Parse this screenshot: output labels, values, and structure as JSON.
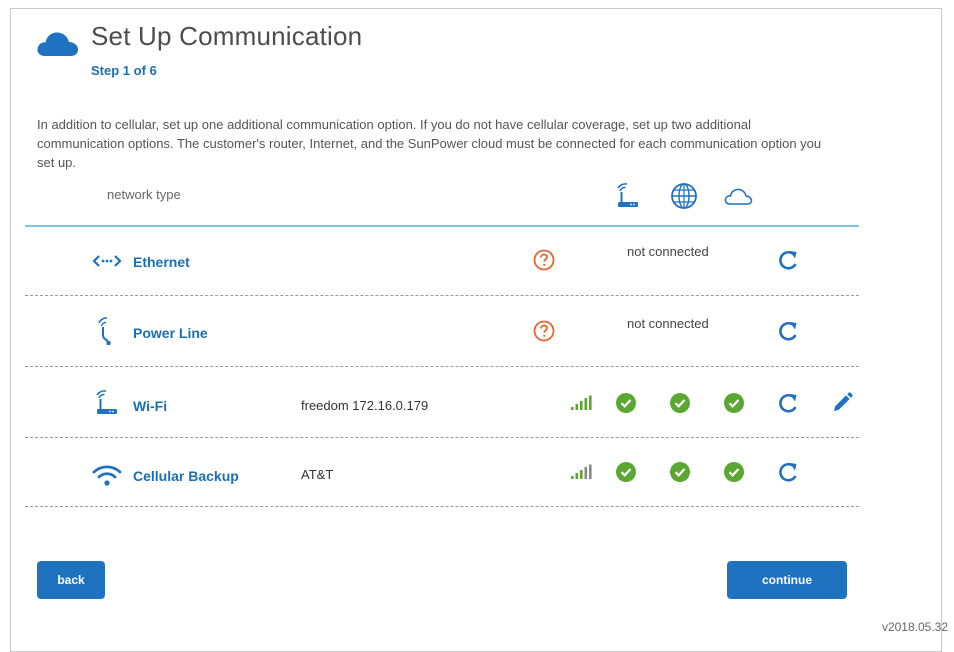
{
  "header": {
    "icon": "cloud-icon",
    "title": "Set Up Communication",
    "step": "Step 1 of 6"
  },
  "intro": {
    "text": "In addition to cellular, set up one additional communication option. If you do not have cellular coverage, set up two additional communication options. The customer's router, Internet, and the SunPower cloud must be connected for each communication option you set up."
  },
  "table": {
    "column_label": "network type",
    "column_icons": [
      "router-icon",
      "globe-icon",
      "cloud-outline-icon"
    ],
    "rows": [
      {
        "icon": "ethernet-icon",
        "label": "Ethernet",
        "detail": "",
        "status_icon": "question-circle-icon",
        "status_text": "not connected",
        "action_icon": "refresh-icon"
      },
      {
        "icon": "power-line-icon",
        "label": "Power Line",
        "detail": "",
        "status_icon": "question-circle-icon",
        "status_text": "not connected",
        "action_icon": "refresh-icon"
      },
      {
        "icon": "wifi-router-icon",
        "label": "Wi-Fi",
        "detail": "freedom 172.16.0.179",
        "signal_icon": "signal-bars-icon",
        "checks": [
          "check-circle-icon",
          "check-circle-icon",
          "check-circle-icon"
        ],
        "action_icon": "refresh-icon",
        "edit_icon": "pencil-icon"
      },
      {
        "icon": "wifi-icon",
        "label": "Cellular Backup",
        "detail": "AT&T",
        "signal_icon": "signal-bars-icon",
        "checks": [
          "check-circle-icon",
          "check-circle-icon",
          "check-circle-icon"
        ],
        "action_icon": "refresh-icon"
      }
    ]
  },
  "footer": {
    "back_label": "back",
    "continue_label": "continue",
    "version": "v2018.05.32"
  },
  "colors": {
    "accent": "#1f72bf",
    "link": "#1a6fb5",
    "header_rule": "#7fc3e6",
    "success": "#5aa832",
    "warning": "#e8622b"
  }
}
